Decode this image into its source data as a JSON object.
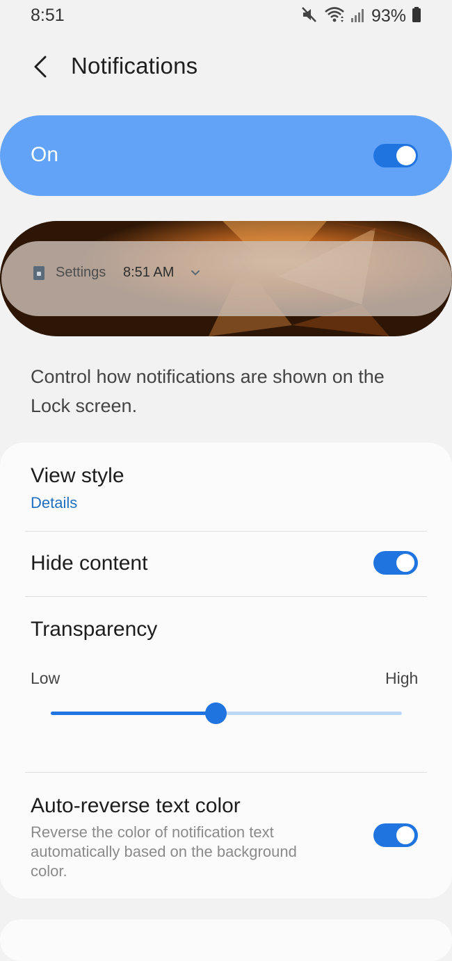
{
  "status_bar": {
    "time": "8:51",
    "battery": "93%"
  },
  "header": {
    "title": "Notifications"
  },
  "master_switch": {
    "label": "On",
    "enabled": true
  },
  "preview": {
    "app_name": "Settings",
    "time": "8:51 AM"
  },
  "description": "Control how notifications are shown on the Lock screen.",
  "settings": {
    "view_style": {
      "title": "View style",
      "value": "Details"
    },
    "hide_content": {
      "title": "Hide content",
      "enabled": true
    },
    "transparency": {
      "title": "Transparency",
      "low_label": "Low",
      "high_label": "High",
      "level": 0.47
    },
    "auto_reverse": {
      "title": "Auto-reverse text color",
      "description": "Reverse the color of notification text automatically based on the background color.",
      "enabled": true
    }
  },
  "colors": {
    "accent": "#1f74e0",
    "switch_bar": "#62a2f7",
    "link": "#1f6fbf"
  }
}
